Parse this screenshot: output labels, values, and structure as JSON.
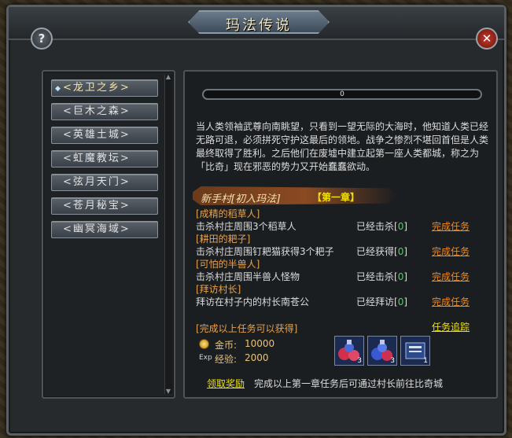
{
  "window": {
    "title": "玛法传说",
    "help_label": "?",
    "close_label": "✕"
  },
  "zones": [
    {
      "label": "龙卫之乡",
      "active": true
    },
    {
      "label": "巨木之森",
      "active": false
    },
    {
      "label": "英雄土城",
      "active": false
    },
    {
      "label": "虹魔教坛",
      "active": false
    },
    {
      "label": "弦月天门",
      "active": false
    },
    {
      "label": "苍月秘宝",
      "active": false
    },
    {
      "label": "幽冥海域",
      "active": false
    }
  ],
  "scroll": {
    "up": "▲",
    "down": "▼"
  },
  "progress": {
    "text": "0",
    "value": 0
  },
  "story": "当人类领袖武尊向南眺望，只看到一望无际的大海时，他知道人类已经无路可退，必须拼死守护这最后的领地。战争之惨烈不堪回首但是人类最终取得了胜利。之后他们在废墟中建立起第一座人类都城，称之为「比奇」现在邪恶的势力又开始蠢蠢欲动。",
  "chapter": {
    "title": "新手村[初入玛法]",
    "badge": "【第一章】"
  },
  "tasks": [
    {
      "head": "[成精的稻草人]",
      "desc": "击杀村庄周围3个稻草人",
      "status_prefix": "已经击杀[",
      "count": "0",
      "status_suffix": "]",
      "link": "完成任务"
    },
    {
      "head": "[耕田的耙子]",
      "desc": "击杀村庄周围钉耙猫获得3个耙子",
      "status_prefix": "已经获得[",
      "count": "0",
      "status_suffix": "]",
      "link": "完成任务"
    },
    {
      "head": "[可怕的半兽人]",
      "desc": "击杀村庄周围半兽人怪物",
      "status_prefix": "已经击杀[",
      "count": "0",
      "status_suffix": "]",
      "link": "完成任务"
    },
    {
      "head": "[拜访村长]",
      "desc": "拜访在村子内的村长南苍公",
      "status_prefix": "已经拜访[",
      "count": "0",
      "status_suffix": "]",
      "link": "完成任务"
    }
  ],
  "reward": {
    "head": "[完成以上任务可以获得]",
    "track_link": "任务追踪",
    "gold_label": "金币:",
    "gold_value": "10000",
    "exp_icon": "Exp",
    "exp_label": "经验:",
    "exp_value": "2000",
    "items": [
      {
        "icon": "red-potion-icon",
        "qty": "3"
      },
      {
        "icon": "blue-potion-icon",
        "qty": "3"
      },
      {
        "icon": "scroll-icon",
        "qty": "1"
      }
    ]
  },
  "footer": {
    "claim_link": "领取奖励",
    "note": "完成以上第一章任务后可通过村长前往比奇城"
  },
  "colors": {
    "task_head": "#e8a24a",
    "task_link": "#f08a1c",
    "count": "#3ddc4a",
    "highlight": "#f0e000"
  }
}
